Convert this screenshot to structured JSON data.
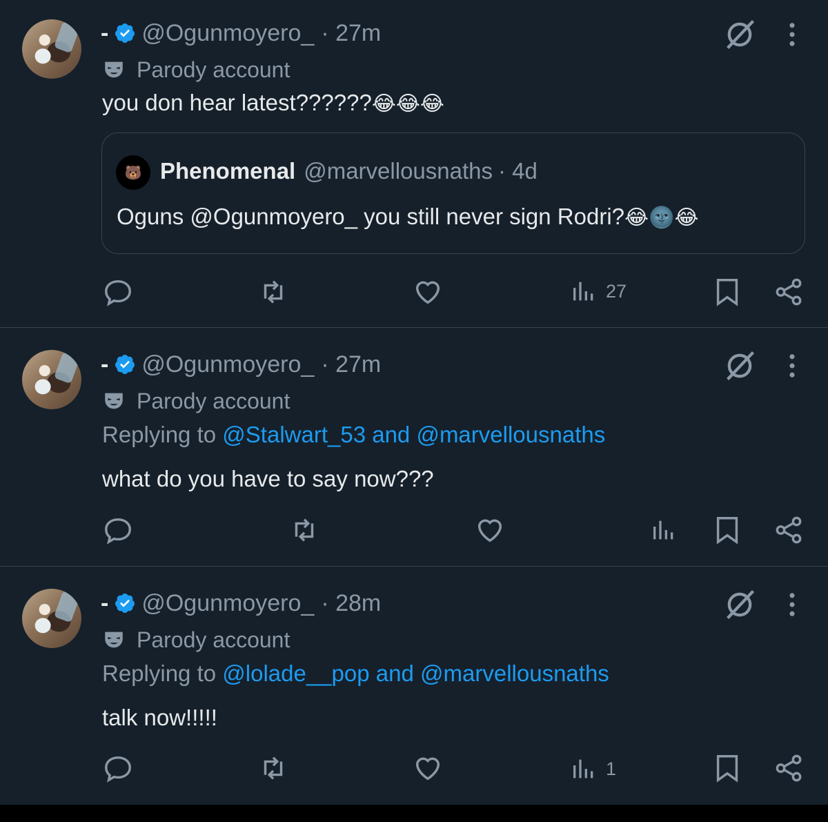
{
  "tweets": [
    {
      "display_name": "-",
      "handle": "@Ogunmoyero_",
      "time": "· 27m",
      "parody_label": "Parody account",
      "text": "you don hear latest??????",
      "text_emoji": "😂😂😂",
      "quote": {
        "name": "Phenomenal",
        "handle": "@marvellousnaths",
        "time": "· 4d",
        "avatar_glyph": "🐻",
        "text": "Oguns @Ogunmoyero_ you still never sign Rodri?",
        "text_emoji": "😂🌚😂"
      },
      "views": "27"
    },
    {
      "display_name": "-",
      "handle": "@Ogunmoyero_",
      "time": "· 27m",
      "parody_label": "Parody account",
      "replying_prefix": "Replying to",
      "replying_links": "@Stalwart_53 and @marvellousnaths",
      "text": "what do you have to say now???",
      "views": ""
    },
    {
      "display_name": "-",
      "handle": "@Ogunmoyero_",
      "time": "· 28m",
      "parody_label": "Parody account",
      "replying_prefix": "Replying to",
      "replying_links": "@lolade__pop and @marvellousnaths",
      "text": "talk now!!!!!",
      "views": "1"
    }
  ],
  "colors": {
    "background": "#15202b",
    "primary_text": "#e7e9ea",
    "secondary_text": "#8b98a5",
    "link": "#1d9bf0",
    "verified": "#1d9bf0",
    "border": "#38444d"
  },
  "icons": [
    "verified-badge-icon",
    "parody-mask-icon",
    "grok-icon",
    "more-icon",
    "reply-icon",
    "retweet-icon",
    "like-icon",
    "views-icon",
    "bookmark-icon",
    "share-icon"
  ]
}
